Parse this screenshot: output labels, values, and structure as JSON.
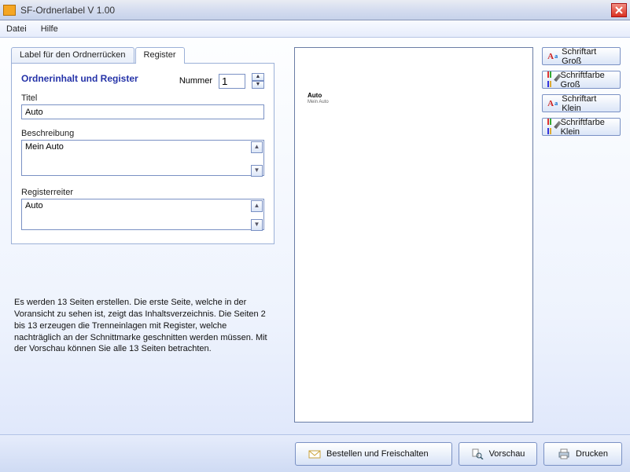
{
  "window": {
    "title": "SF-Ordnerlabel  V 1.00"
  },
  "menubar": {
    "file": "Datei",
    "help": "Hilfe"
  },
  "tabs": {
    "tab1": "Label für den Ordnerrücken",
    "tab2": "Register"
  },
  "form": {
    "heading": "Ordnerinhalt und Register",
    "number_label": "Nummer",
    "number_value": "1",
    "title_label": "Titel",
    "title_value": "Auto",
    "desc_label": "Beschreibung",
    "desc_value": "Mein Auto",
    "regtab_label": "Registerreiter",
    "regtab_value": "Auto"
  },
  "info_text": "Es werden 13 Seiten erstellen. Die erste Seite, welche in der Voransicht zu sehen ist, zeigt das Inhaltsverzeichnis. Die Seiten 2 bis 13 erzeugen die Trenneinlagen mit Register, welche nachträglich an der Schnittmarke geschnitten werden müssen. Mit der Vorschau können Sie alle 13 Seiten betrachten.",
  "preview": {
    "title": "Auto",
    "desc": "Mein Auto"
  },
  "right_buttons": {
    "font_large": "Schriftart Groß",
    "color_large": "Schriftfarbe Groß",
    "font_small": "Schriftart Klein",
    "color_small": "Schriftfarbe Klein"
  },
  "bottom_buttons": {
    "order": "Bestellen und Freischalten",
    "preview": "Vorschau",
    "print": "Drucken"
  }
}
